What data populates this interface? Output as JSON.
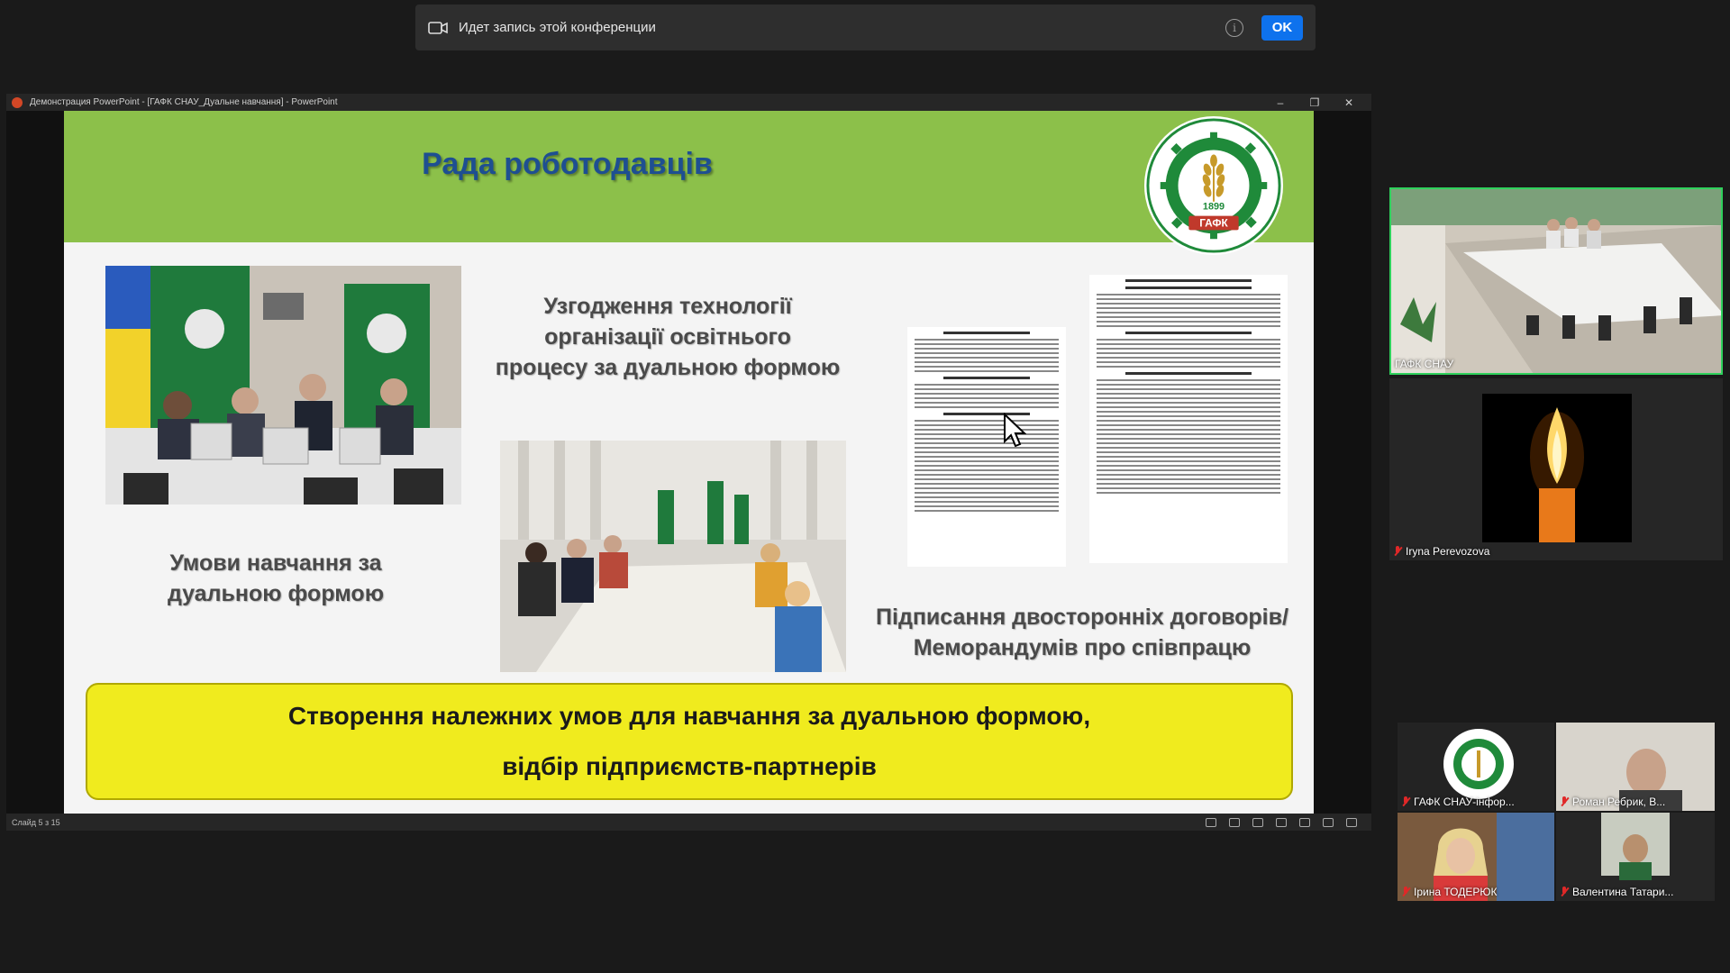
{
  "recording": {
    "text": "Идет запись этой конференции",
    "ok_label": "OK"
  },
  "ppt": {
    "window_title": "Демонстрация PowerPoint - [ГАФК СНАУ_Дуальне навчання] - PowerPoint",
    "status_text": "Слайд 5 з 15",
    "controls": {
      "minimize": "–",
      "restore": "❐",
      "close": "✕"
    }
  },
  "slide": {
    "title": "Рада роботодавців",
    "logo_year": "1899",
    "logo_abbr": "ГАФК",
    "caption_top": [
      "Узгодження технології",
      "організації освітнього",
      "процесу за дуальною формою"
    ],
    "caption_left": [
      "Умови навчання за",
      "дуальною формою"
    ],
    "caption_right": [
      "Підписання двосторонніх договорів/",
      "Меморандумів про співпрацю"
    ],
    "banner": [
      "Створення належних умов для навчання за дуальною формою,",
      "відбір підприємств-партнерів"
    ]
  },
  "participants": [
    {
      "name": "ГАФК СНАУ"
    },
    {
      "name": "Iryna Perevozova"
    },
    {
      "name": "ГАФК СНАУ-інфор..."
    },
    {
      "name": "Роман Ребрик, В..."
    },
    {
      "name": "Ірина ТОДЕРЮК"
    },
    {
      "name": "Валентина Татари..."
    }
  ],
  "colors": {
    "header_green": "#8cc04a",
    "title_blue": "#1e4f91",
    "banner_yellow": "#f0eb1e",
    "ok_blue": "#0e72ed",
    "active_speaker": "#2fd15c"
  }
}
